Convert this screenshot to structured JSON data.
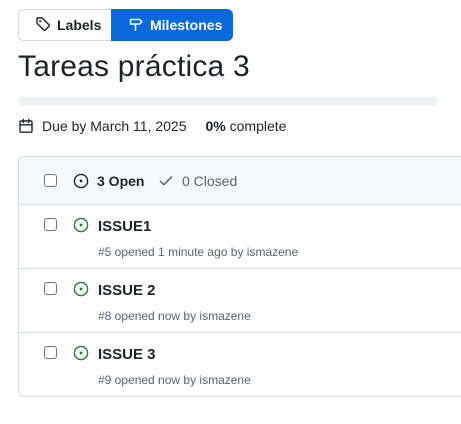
{
  "tabs": {
    "labels": "Labels",
    "milestones": "Milestones"
  },
  "milestone": {
    "title": "Tareas práctica 3",
    "progress_percent": 0,
    "due": "Due by March 11, 2025",
    "percent": "0%",
    "complete": "complete"
  },
  "list": {
    "open_label": "3 Open",
    "closed_label": "0 Closed",
    "issues": [
      {
        "title": "ISSUE1",
        "meta": "#5 opened 1 minute ago by ismazene"
      },
      {
        "title": "ISSUE 2",
        "meta": "#8 opened now by ismazene"
      },
      {
        "title": "ISSUE 3",
        "meta": "#9 opened now by ismazene"
      }
    ]
  },
  "colors": {
    "accent": "#0969da",
    "open": "#1a7f37",
    "border": "#d1d9e0"
  },
  "icons": {
    "labels_tab": "tag-icon",
    "milestones_tab": "milestone-icon",
    "due": "calendar-icon",
    "open": "issue-opened-icon",
    "closed": "check-icon"
  }
}
